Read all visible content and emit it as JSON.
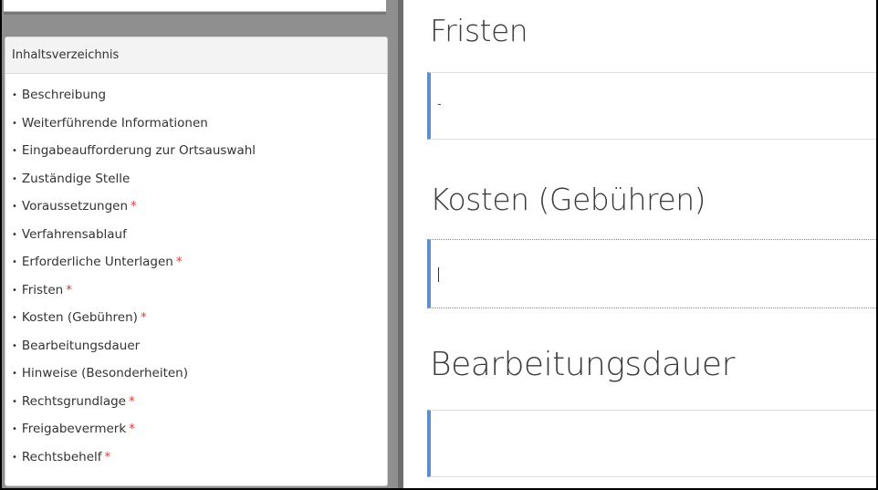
{
  "toc": {
    "title": "Inhaltsverzeichnis",
    "items": [
      {
        "label": "Beschreibung",
        "required": ""
      },
      {
        "label": "Weiterführende Informationen",
        "required": ""
      },
      {
        "label": "Eingabeaufforderung zur Ortsauswahl",
        "required": ""
      },
      {
        "label": "Zuständige Stelle",
        "required": ""
      },
      {
        "label": "Voraussetzungen",
        "required": "*"
      },
      {
        "label": "Verfahrensablauf",
        "required": ""
      },
      {
        "label": "Erforderliche Unterlagen",
        "required": "*"
      },
      {
        "label": "Fristen",
        "required": "*"
      },
      {
        "label": "Kosten (Gebühren)",
        "required": "*"
      },
      {
        "label": "Bearbeitungsdauer",
        "required": ""
      },
      {
        "label": "Hinweise (Besonderheiten)",
        "required": ""
      },
      {
        "label": "Rechtsgrundlage",
        "required": "*"
      },
      {
        "label": "Freigabevermerk",
        "required": "*"
      },
      {
        "label": "Rechtsbehelf",
        "required": "*"
      }
    ]
  },
  "sections": {
    "fristen": {
      "title": "Fristen",
      "value": "-"
    },
    "kosten": {
      "title": "Kosten (Gebühren)",
      "value": ""
    },
    "bearbeitungsdauer": {
      "title": "Bearbeitungsdauer",
      "value": ""
    }
  },
  "colors": {
    "accent": "#5b8fd0",
    "required": "#e53935"
  }
}
